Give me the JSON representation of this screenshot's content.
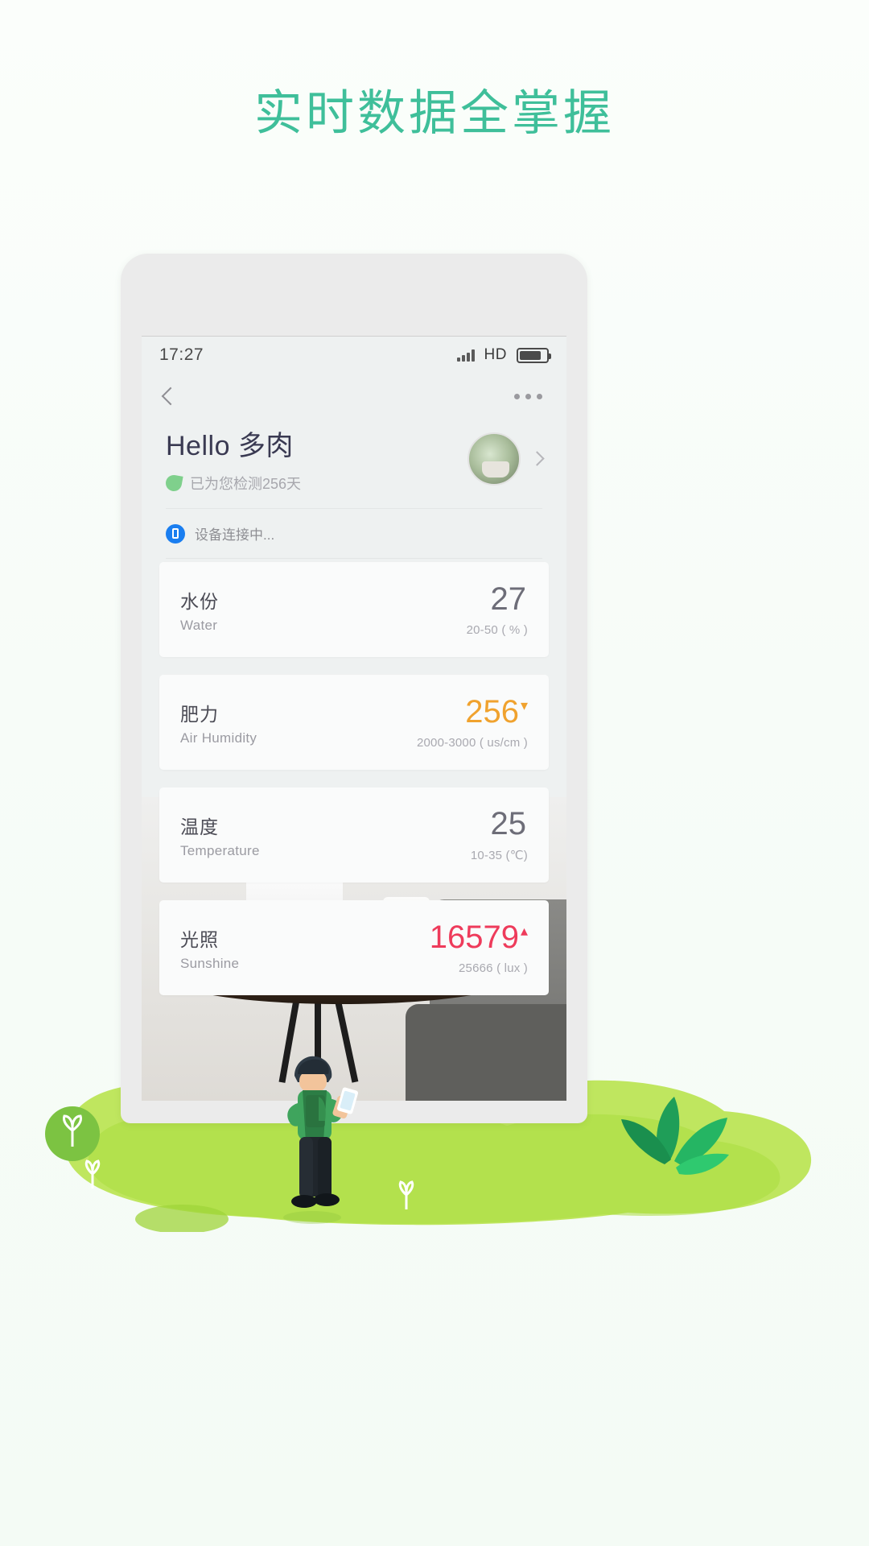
{
  "headline": "实时数据全掌握",
  "colors": {
    "headline": "#3fbf9a",
    "accent_orange": "#f0a22e",
    "accent_red": "#ee3b5b",
    "grass": "#b5e05a"
  },
  "phone": {
    "status_bar": {
      "time": "17:27",
      "signal_icon": "signal-bars-icon",
      "network_label": "HD",
      "battery_icon": "battery-icon"
    },
    "nav": {
      "back_icon": "back-chevron-icon",
      "more_icon": "more-options-icon"
    },
    "header": {
      "greeting": "Hello 多肉",
      "leaf_icon": "leaf-icon",
      "subtitle": "已为您检测256天",
      "avatar": "plant-avatar",
      "chevron_icon": "chevron-right-icon"
    },
    "connection": {
      "icon": "bluetooth-device-icon",
      "status": "设备连接中..."
    },
    "cards": [
      {
        "cn": "水份",
        "en": "Water",
        "value": "27",
        "range": "20-50 ( % )",
        "trend": "",
        "color": "default"
      },
      {
        "cn": "肥力",
        "en": "Air Humidity",
        "value": "256",
        "range": "2000-3000 ( us/cm )",
        "trend": "▾",
        "color": "orange"
      },
      {
        "cn": "温度",
        "en": "Temperature",
        "value": "25",
        "range": "10-35 (℃)",
        "trend": "",
        "color": "default"
      },
      {
        "cn": "光照",
        "en": "Sunshine",
        "value": "16579",
        "range": "25666 ( lux )",
        "trend": "▴",
        "color": "red"
      }
    ]
  },
  "scene": {
    "person_icon": "person-with-phone-illustration",
    "grass_icon": "grass-blob-illustration",
    "succulent_icon": "succulent-plant-illustration",
    "sprout_icon": "sprout-illustration"
  }
}
